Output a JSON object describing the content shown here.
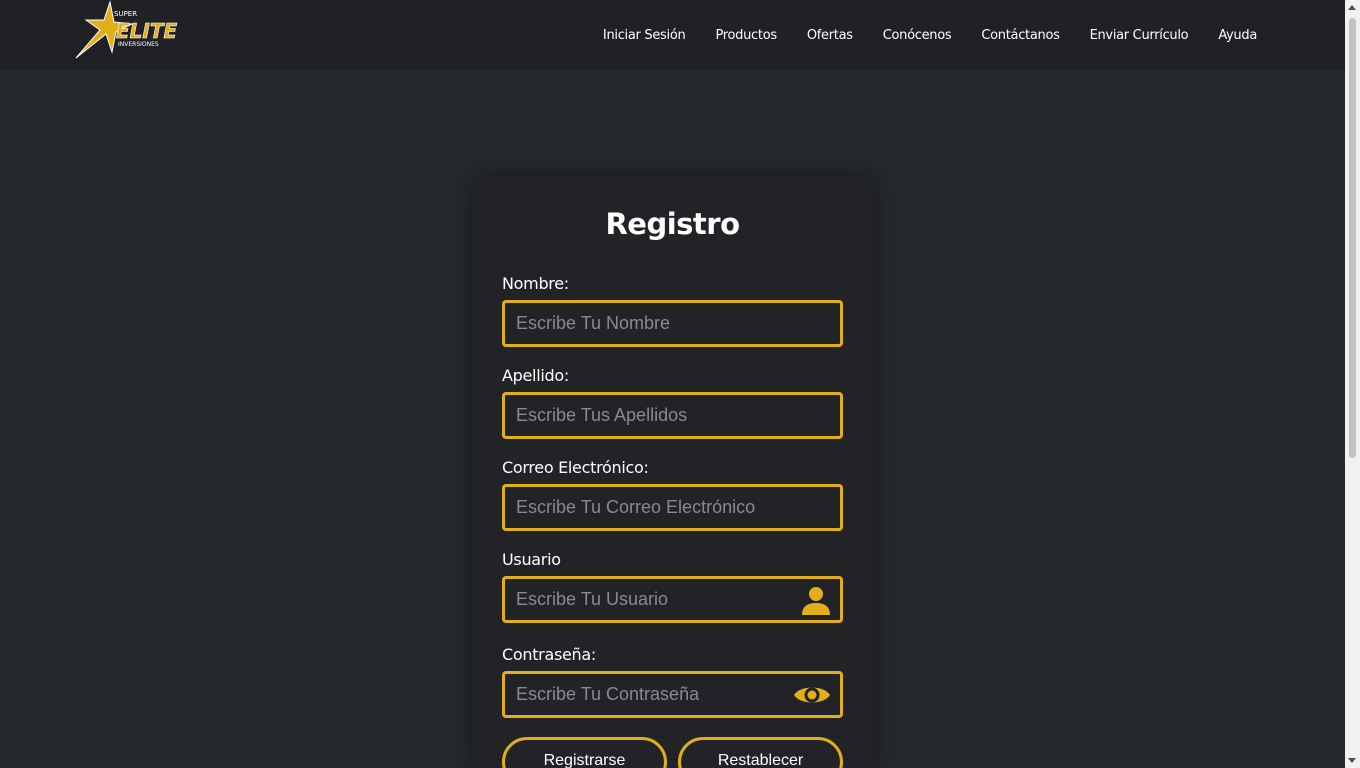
{
  "header": {
    "logo_alt": "Super Elite Inversiones",
    "logo_text_top": "SUPER",
    "logo_text_main": "ELITE",
    "logo_text_bottom": "INVERSIONES",
    "nav": [
      {
        "label": "Iniciar Sesión"
      },
      {
        "label": "Productos"
      },
      {
        "label": "Ofertas"
      },
      {
        "label": "Conócenos"
      },
      {
        "label": "Contáctanos"
      },
      {
        "label": "Enviar Currículo"
      },
      {
        "label": "Ayuda"
      }
    ]
  },
  "form": {
    "title": "Registro",
    "fields": [
      {
        "label": "Nombre:",
        "placeholder": "Escribe Tu Nombre",
        "icon": ""
      },
      {
        "label": "Apellido:",
        "placeholder": "Escribe Tus Apellidos",
        "icon": ""
      },
      {
        "label": "Correo Electrónico:",
        "placeholder": "Escribe Tu Correo Electrónico",
        "icon": ""
      },
      {
        "label": "Usuario",
        "placeholder": "Escribe Tu Usuario",
        "icon": "user-icon"
      },
      {
        "label": "Contraseña:",
        "placeholder": "Escribe Tu Contraseña",
        "icon": "eye-icon"
      }
    ],
    "buttons": {
      "submit": "Registrarse",
      "reset": "Restablecer"
    }
  },
  "colors": {
    "accent": "#e2ae1a",
    "background": "#26292e",
    "topbar": "#1f2124",
    "card": "#212327"
  }
}
